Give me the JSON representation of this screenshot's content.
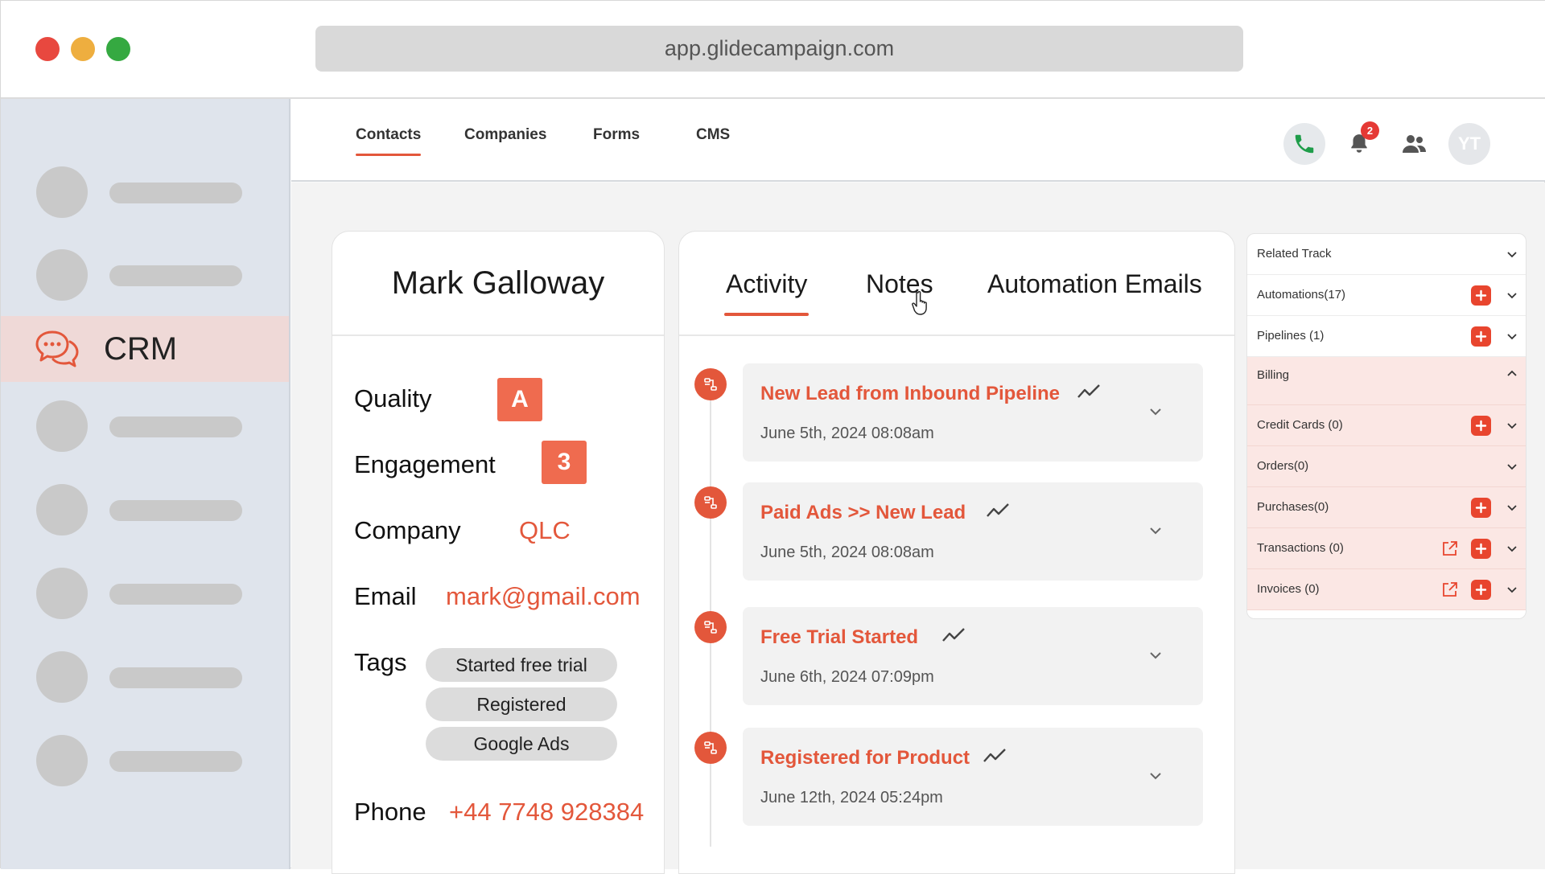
{
  "browser": {
    "url": "app.glidecampaign.com"
  },
  "sidebar": {
    "active_label": "CRM"
  },
  "nav": {
    "tabs": [
      {
        "label": "Contacts",
        "active": true
      },
      {
        "label": "Companies"
      },
      {
        "label": "Forms"
      },
      {
        "label": "CMS"
      }
    ],
    "notification_count": "2",
    "avatar_initials": "YT",
    "icons": [
      "phone-icon",
      "bell-icon",
      "people-icon"
    ]
  },
  "contact": {
    "name": "Mark Galloway",
    "quality_label": "Quality",
    "quality_value": "A",
    "engagement_label": "Engagement",
    "engagement_value": "3",
    "company_label": "Company",
    "company_value": "QLC",
    "email_label": "Email",
    "email_value": "mark@gmail.com",
    "tags_label": "Tags",
    "tags": [
      "Started free trial",
      "Registered",
      "Google Ads"
    ],
    "phone_label": "Phone",
    "phone_value": "+44 7748 928384"
  },
  "activity": {
    "tabs": [
      {
        "label": "Activity",
        "active": true
      },
      {
        "label": "Notes"
      },
      {
        "label": "Automation Emails"
      }
    ],
    "events": [
      {
        "title": "New Lead from Inbound Pipeline",
        "date": "June 5th, 2024 08:08am"
      },
      {
        "title": "Paid Ads >> New Lead",
        "date": "June 5th, 2024 08:08am"
      },
      {
        "title": "Free Trial Started",
        "date": "June 6th, 2024 07:09pm"
      },
      {
        "title": "Registered for Product",
        "date": "June 12th, 2024 05:24pm"
      }
    ]
  },
  "right_panel": {
    "rows": [
      {
        "label": "Related Track",
        "plus": false,
        "external": false,
        "expanded": false
      },
      {
        "label": "Automations(17)",
        "plus": true,
        "external": false,
        "expanded": false
      },
      {
        "label": "Pipelines (1)",
        "plus": true,
        "external": false,
        "expanded": false
      },
      {
        "label": "Billing",
        "plus": false,
        "external": false,
        "expanded": true
      },
      {
        "label": "Credit Cards (0)",
        "plus": true,
        "external": false,
        "expanded": false
      },
      {
        "label": "Orders(0)",
        "plus": false,
        "external": false,
        "expanded": false
      },
      {
        "label": "Purchases(0)",
        "plus": true,
        "external": false,
        "expanded": false
      },
      {
        "label": "Transactions (0)",
        "plus": true,
        "external": true,
        "expanded": false
      },
      {
        "label": "Invoices (0)",
        "plus": true,
        "external": true,
        "expanded": false
      }
    ]
  },
  "colors": {
    "accent": "#e3573b",
    "grade": "#ef6b4f",
    "sidebar_active": "#efd9d7",
    "billing_bg": "#fbe7e4"
  }
}
